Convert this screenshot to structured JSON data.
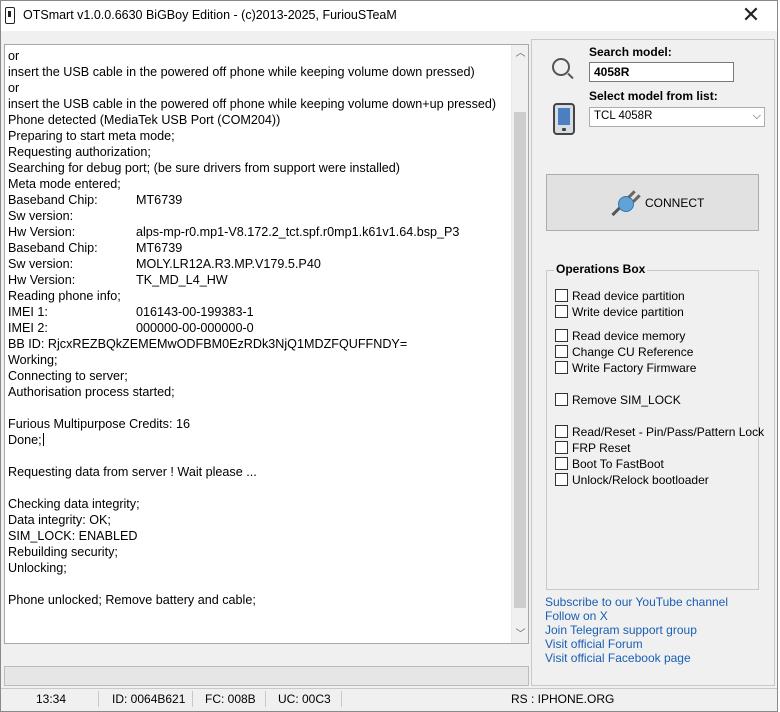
{
  "window": {
    "title": "OTSmart  v1.0.0.6630 BiGBoy Edition - (c)2013-2025, FuriouSTeaM",
    "close_glyph": "✕"
  },
  "log": {
    "lines": [
      {
        "text": "or"
      },
      {
        "text": "insert the USB cable in the powered off phone while keeping volume down pressed)"
      },
      {
        "text": "or"
      },
      {
        "text": "insert the USB cable in the powered off phone while keeping volume down+up pressed)",
        "wrap": true
      },
      {
        "text": "Phone detected (MediaTek USB Port (COM204))"
      },
      {
        "text": "Preparing to start meta mode;"
      },
      {
        "text": "Requesting authorization;"
      },
      {
        "text": "Searching for debug port; (be sure drivers from support were installed)"
      },
      {
        "text": "Meta mode entered;"
      },
      {
        "key": "Baseband Chip:",
        "value": "MT6739"
      },
      {
        "text": "Sw version:"
      },
      {
        "key": "Hw Version:",
        "value": "alps-mp-r0.mp1-V8.172.2_tct.spf.r0mp1.k61v1.64.bsp_P3"
      },
      {
        "key": "Baseband Chip:",
        "value": "MT6739"
      },
      {
        "key": "Sw version:",
        "value": "MOLY.LR12A.R3.MP.V179.5.P40"
      },
      {
        "key": "Hw Version:",
        "value": "TK_MD_L4_HW"
      },
      {
        "text": "Reading phone info;"
      },
      {
        "key": "IMEI 1:",
        "value": "016143-00-199383-1"
      },
      {
        "key": "IMEI 2:",
        "value": "000000-00-000000-0"
      },
      {
        "text": "BB ID: RjcxREZBQkZEMEMwODFBM0EzRDk3NjQ1MDZFQUFFNDY="
      },
      {
        "text": "Working;"
      },
      {
        "text": "Connecting to server;"
      },
      {
        "text": "Authorisation process started;"
      },
      {
        "text": ""
      },
      {
        "text": "Furious Multipurpose Credits: 16"
      },
      {
        "text": "Done;",
        "caret": true
      },
      {
        "text": ""
      },
      {
        "text": "Requesting data from server ! Wait please ..."
      },
      {
        "text": ""
      },
      {
        "text": "Checking data integrity;"
      },
      {
        "text": "Data integrity: OK;"
      },
      {
        "text": "SIM_LOCK: ENABLED"
      },
      {
        "text": "Rebuilding security;"
      },
      {
        "text": "Unlocking;"
      },
      {
        "text": ""
      },
      {
        "text": "Phone unlocked; Remove battery and cable;"
      }
    ]
  },
  "status": {
    "time": "13:34",
    "id": "ID: 0064B621",
    "fc": "FC: 008B",
    "uc": "UC: 00C3",
    "rs": "RS : IPHONE.ORG"
  },
  "search": {
    "label": "Search model:",
    "value": "4058R"
  },
  "model_select": {
    "label": "Select model from list:",
    "selected": "TCL 4058R"
  },
  "connect": {
    "label": "CONNECT"
  },
  "operations": {
    "title": "Operations Box",
    "items": [
      "Read device partition",
      "Write device partition",
      "Read device memory",
      "Change CU Reference",
      "Write Factory Firmware",
      "Remove SIM_LOCK",
      "Read/Reset - Pin/Pass/Pattern Lock",
      "FRP Reset",
      "Boot To FastBoot",
      "Unlock/Relock bootloader"
    ]
  },
  "links": [
    "Subscribe to our YouTube channel",
    "Follow on X",
    "Join Telegram support group",
    "Visit official Forum",
    "Visit official Facebook page"
  ],
  "colors": {
    "link": "#1a5fb4",
    "window_bg": "#f0f0f0"
  }
}
